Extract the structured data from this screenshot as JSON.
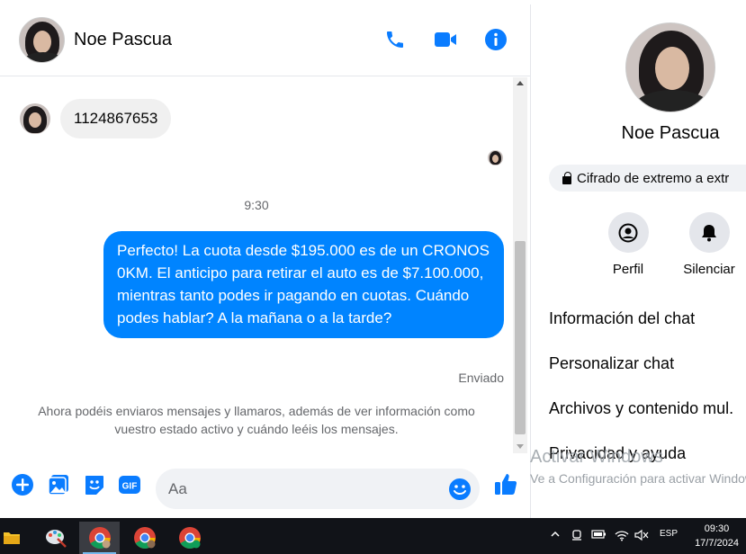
{
  "chat": {
    "contact_name": "Noe Pascua"
  },
  "messages": {
    "incoming_text": "1124867653",
    "timestamp": "9:30",
    "outgoing_text": "Perfecto! La cuota desde $195.000 es de un CRONOS 0KM. El anticipo para retirar el auto es de $7.100.000, mientras tanto podes ir pagando en cuotas. Cuándo podes hablar? A la mañana o a la tarde?",
    "status": "Enviado",
    "notice": "Ahora podéis enviaros mensajes y llamaros, además de ver información como vuestro estado activo y cuándo leéis los mensajes."
  },
  "composer": {
    "placeholder": "Aa"
  },
  "info_panel": {
    "name": "Noe Pascua",
    "encryption": "Cifrado de extremo a extr",
    "actions": [
      {
        "label": "Perfil",
        "icon": "profile-icon"
      },
      {
        "label": "Silenciar",
        "icon": "bell-icon"
      }
    ],
    "menu": [
      "Información del chat",
      "Personalizar chat",
      "Archivos y contenido mul.",
      "Privacidad y ayuda"
    ]
  },
  "watermark": {
    "title": "Activar Windows",
    "subtitle": "Ve a Configuración para activar Windows."
  },
  "taskbar": {
    "language": "ESP",
    "time": "09:30",
    "date": "17/7/2024"
  },
  "colors": {
    "messenger_blue": "#0084ff",
    "icon_blue": "#0a7cff"
  }
}
